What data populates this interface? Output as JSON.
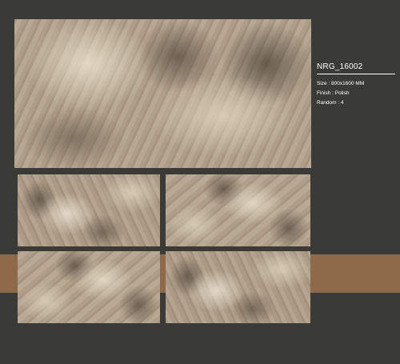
{
  "product": {
    "code": "NRG_16002",
    "size": "Size : 800x1600 MM",
    "finish": "Finish : Polish",
    "random": "Random : 4"
  },
  "images": {
    "main": "large-marble-slab",
    "variants": [
      "marble-variant-1",
      "marble-variant-2",
      "marble-variant-3",
      "marble-variant-4"
    ]
  },
  "colors": {
    "background": "#3a3b37",
    "accent_band": "#8e6a4b",
    "text": "#ffffff"
  }
}
